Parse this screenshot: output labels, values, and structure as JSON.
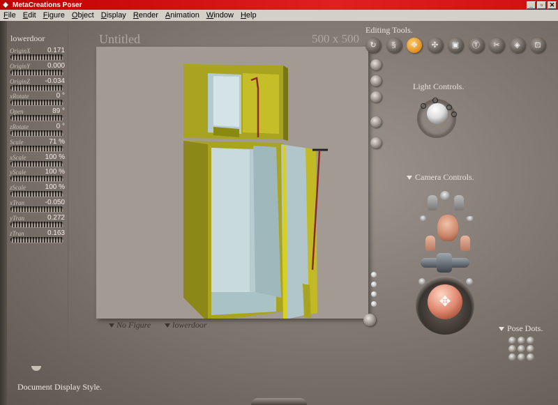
{
  "window": {
    "title": "MetaCreations Poser",
    "controls": [
      "_",
      "▫",
      "✕"
    ]
  },
  "menu": [
    {
      "label": "File",
      "mnemonic": "F",
      "rest": "ile"
    },
    {
      "label": "Edit",
      "mnemonic": "E",
      "rest": "dit"
    },
    {
      "label": "Figure",
      "mnemonic": "F",
      "rest": "igure"
    },
    {
      "label": "Object",
      "mnemonic": "O",
      "rest": "bject"
    },
    {
      "label": "Display",
      "mnemonic": "D",
      "rest": "isplay"
    },
    {
      "label": "Render",
      "mnemonic": "R",
      "rest": "ender"
    },
    {
      "label": "Animation",
      "mnemonic": "A",
      "rest": "nimation"
    },
    {
      "label": "Window",
      "mnemonic": "W",
      "rest": "indow"
    },
    {
      "label": "Help",
      "mnemonic": "H",
      "rest": "elp"
    }
  ],
  "parameters": {
    "actor": "lowerdoor",
    "dials": [
      {
        "name": "OriginX",
        "value": "0.171"
      },
      {
        "name": "OriginY",
        "value": "0.000"
      },
      {
        "name": "OriginZ",
        "value": "-0.034"
      },
      {
        "name": "xRotate",
        "value": "0 °"
      },
      {
        "name": "Open",
        "value": "89 °"
      },
      {
        "name": "zRotate",
        "value": "0 °"
      },
      {
        "name": "Scale",
        "value": "71 %"
      },
      {
        "name": "xScale",
        "value": "100 %"
      },
      {
        "name": "yScale",
        "value": "100 %"
      },
      {
        "name": "zScale",
        "value": "100 %"
      },
      {
        "name": "xTran",
        "value": "-0.050"
      },
      {
        "name": "yTran",
        "value": "0.272"
      },
      {
        "name": "zTran",
        "value": "0.163"
      }
    ]
  },
  "document": {
    "title": "Untitled",
    "size": "500 x 500",
    "figure_menu": "No Figure",
    "actor_menu": "lowerdoor",
    "display_style_label": "Document Display Style."
  },
  "editing_tools": {
    "label": "Editing Tools.",
    "tools": [
      {
        "icon": "rotate-icon",
        "glyph": "↻",
        "active": false
      },
      {
        "icon": "twist-icon",
        "glyph": "§",
        "active": false
      },
      {
        "icon": "translate-icon",
        "glyph": "✥",
        "active": true
      },
      {
        "icon": "translate-in-out-icon",
        "glyph": "✣",
        "active": false
      },
      {
        "icon": "scale-icon",
        "glyph": "▣",
        "active": false
      },
      {
        "icon": "taper-icon",
        "glyph": "Ⓣ",
        "active": false
      },
      {
        "icon": "chain-break-icon",
        "glyph": "✂",
        "active": false
      },
      {
        "icon": "color-icon",
        "glyph": "◈",
        "active": false
      },
      {
        "icon": "view-magnifier-icon",
        "glyph": "⊡",
        "active": false
      }
    ]
  },
  "light_controls": {
    "label": "Light Controls."
  },
  "camera_controls": {
    "label": "Camera Controls."
  },
  "pose_dots": {
    "label": "Pose Dots."
  },
  "colors": {
    "title_bar": "#d01010",
    "menu_bar": "#d4d0c8",
    "viewport_bg": "#a49a94",
    "fridge": "#a8a420",
    "fridge_interior": "#b4cace",
    "active_tool": "#e08c20"
  }
}
